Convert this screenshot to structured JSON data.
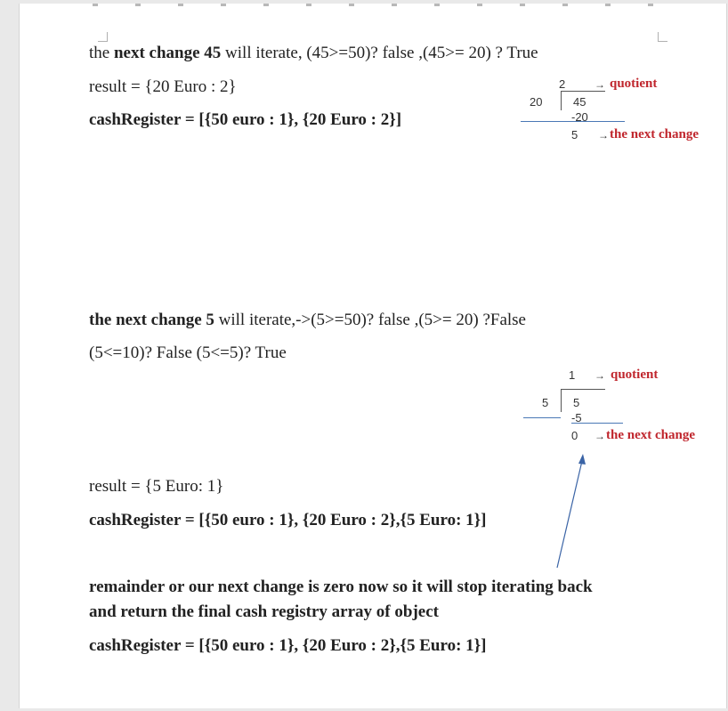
{
  "block1": {
    "line1": {
      "pre": "the ",
      "bold": "next change 45",
      "post": " will iterate, (45>=50)? false ,(45>= 20) ? True"
    },
    "result": "result = {20 Euro : 2}",
    "cash": "cashRegister = [{50 euro : 1}, {20 Euro : 2}]"
  },
  "division1": {
    "quotient": "2",
    "divisor": "20",
    "dividend": "45",
    "subtract": "-20",
    "remainder": "5",
    "quotient_label": "quotient",
    "remainder_label": "the next  change"
  },
  "block2": {
    "line1": {
      "bold": "the next change 5",
      "post": " will iterate,->(5>=50)? false ,(5>= 20) ?False"
    },
    "line2": "(5<=10)? False (5<=5)? True"
  },
  "division2": {
    "quotient": "1",
    "divisor": "5",
    "dividend": "5",
    "subtract": "-5",
    "remainder": "0",
    "quotient_label": "quotient",
    "remainder_label": "the next  change"
  },
  "block3": {
    "result": "result = {5 Euro: 1}",
    "cash": "cashRegister = [{50 euro : 1}, {20 Euro : 2},{5 Euro: 1}]",
    "conclusion_1": "remainder or our next change is zero now so it will stop iterating back",
    "conclusion_2": "and return the final cash registry array of object",
    "final_cash": "cashRegister = [{50 euro : 1}, {20 Euro : 2},{5 Euro: 1}]"
  },
  "arrow_glyph": "→",
  "colors": {
    "label_red": "#c0262d",
    "rule_blue": "#4a78b5",
    "pointer_blue": "#3b64a6"
  }
}
